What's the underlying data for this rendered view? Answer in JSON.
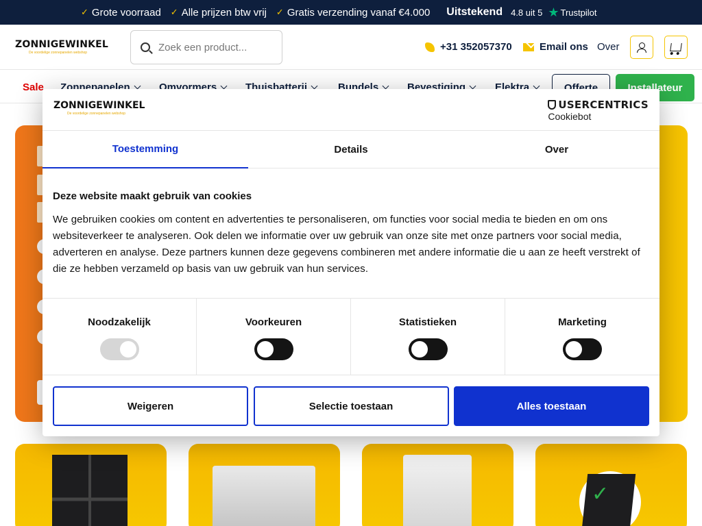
{
  "topbar": {
    "usps": [
      "Grote voorraad",
      "Alle prijzen btw vrij",
      "Gratis verzending vanaf €4.000"
    ],
    "rating_word": "Uitstekend",
    "rating_score": "4.8 uit 5",
    "trustpilot": "Trustpilot"
  },
  "header": {
    "logo_brand": "ZONNIGEWINKEL",
    "logo_tagline": "De voordelige zonnepanelen webshop",
    "search_placeholder": "Zoek een product...",
    "phone": "+31 352057370",
    "email_label": "Email ons",
    "over_label": "Over"
  },
  "nav": {
    "items": [
      {
        "label": "Sale",
        "dropdown": false
      },
      {
        "label": "Zonnepanelen",
        "dropdown": true
      },
      {
        "label": "Omvormers",
        "dropdown": true
      },
      {
        "label": "Thuisbatterij",
        "dropdown": true
      },
      {
        "label": "Bundels",
        "dropdown": true
      },
      {
        "label": "Bevestiging",
        "dropdown": true
      },
      {
        "label": "Elektra",
        "dropdown": true
      }
    ],
    "offerte_label": "Offerte",
    "installateur_label": "Installateur"
  },
  "colors": {
    "navy": "#0e1f3d",
    "brand_yellow": "#f5c400",
    "cookie_blue": "#1032cf",
    "install_green": "#2fb24c",
    "sale_red": "#e00000"
  },
  "cookie": {
    "provider_line1": "USERCENTRICS",
    "provider_line2": "Cookiebot",
    "tabs": [
      {
        "label": "Toestemming",
        "active": true
      },
      {
        "label": "Details",
        "active": false
      },
      {
        "label": "Over",
        "active": false
      }
    ],
    "heading": "Deze website maakt gebruik van cookies",
    "body": "We gebruiken cookies om content en advertenties te personaliseren, om functies voor social media te bieden en om ons websiteverkeer te analyseren. Ook delen we informatie over uw gebruik van onze site met onze partners voor social media, adverteren en analyse. Deze partners kunnen deze gegevens combineren met andere informatie die u aan ze heeft verstrekt of die ze hebben verzameld op basis van uw gebruik van hun services.",
    "categories": [
      {
        "label": "Noodzakelijk",
        "enabled": true,
        "locked": true
      },
      {
        "label": "Voorkeuren",
        "enabled": false,
        "locked": false
      },
      {
        "label": "Statistieken",
        "enabled": false,
        "locked": false
      },
      {
        "label": "Marketing",
        "enabled": false,
        "locked": false
      }
    ],
    "buttons": {
      "deny": "Weigeren",
      "selection": "Selectie toestaan",
      "allow_all": "Alles toestaan"
    }
  }
}
